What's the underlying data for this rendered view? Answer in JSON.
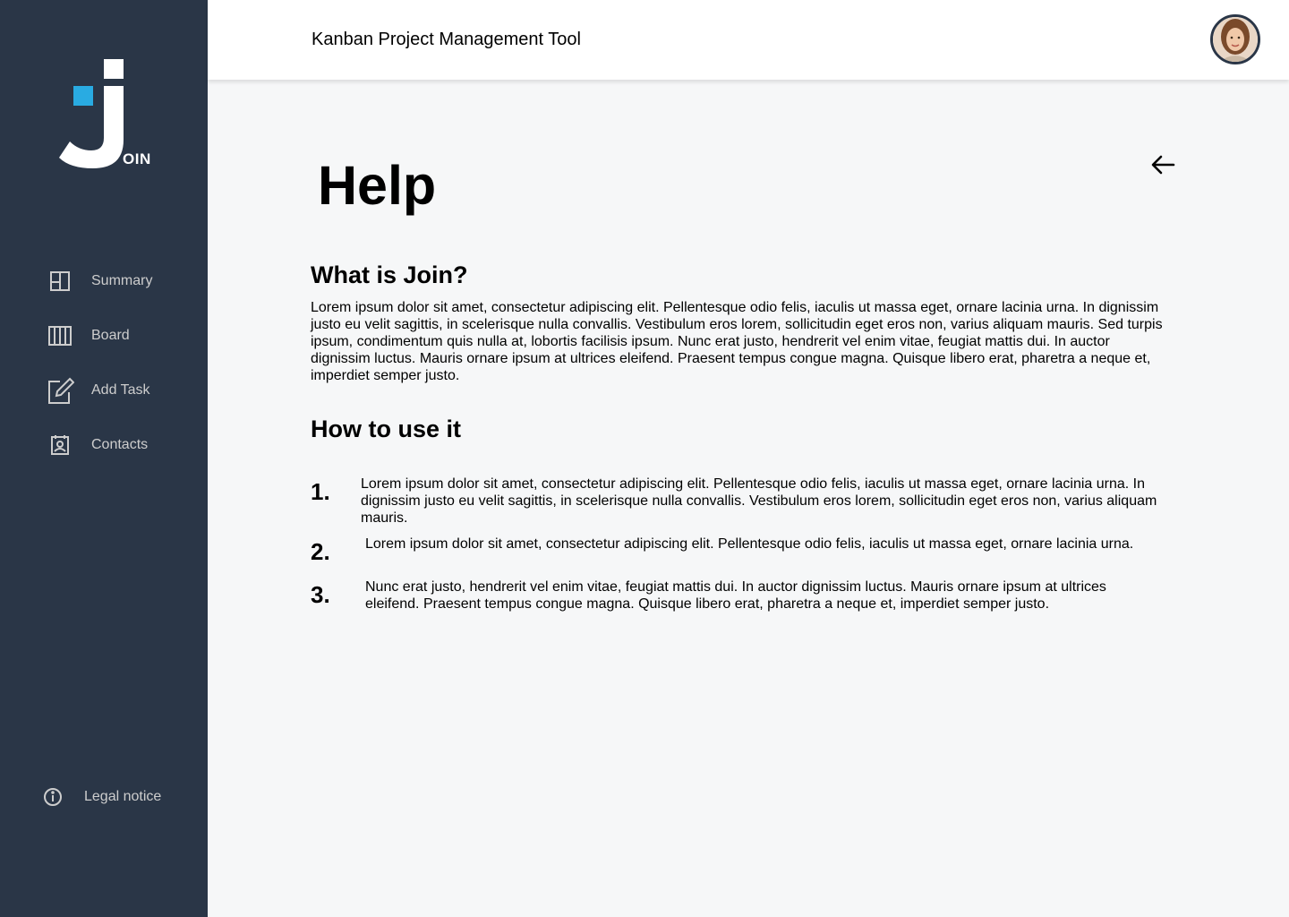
{
  "app": {
    "title": "Kanban Project Management Tool",
    "logo_text": "OIN"
  },
  "sidebar": {
    "items": [
      {
        "label": "Summary",
        "icon": "summary-icon"
      },
      {
        "label": "Board",
        "icon": "board-icon"
      },
      {
        "label": "Add Task",
        "icon": "add-task-icon"
      },
      {
        "label": "Contacts",
        "icon": "contacts-icon"
      }
    ],
    "legal": {
      "label": "Legal notice",
      "icon": "info-icon"
    }
  },
  "page": {
    "title": "Help",
    "section1_title": "What is Join?",
    "section1_text": "Lorem ipsum dolor sit amet, consectetur adipiscing elit. Pellentesque odio felis, iaculis ut massa eget, ornare lacinia urna. In dignissim justo eu velit sagittis, in scelerisque nulla convallis. Vestibulum eros lorem, sollicitudin eget eros non, varius aliquam mauris. Sed turpis ipsum, condimentum quis nulla at, lobortis facilisis ipsum. Nunc erat justo, hendrerit vel enim vitae, feugiat mattis dui. In auctor dignissim luctus. Mauris ornare ipsum at ultrices eleifend. Praesent tempus congue magna. Quisque libero erat, pharetra a neque et, imperdiet semper justo.",
    "section2_title": "How to use it",
    "steps": [
      {
        "num": "1.",
        "text": "Lorem ipsum dolor sit amet, consectetur adipiscing elit. Pellentesque odio felis, iaculis ut massa eget, ornare lacinia urna. In dignissim justo eu velit sagittis, in scelerisque nulla convallis. Vestibulum eros lorem, sollicitudin eget eros non, varius aliquam mauris."
      },
      {
        "num": "2.",
        "text": "Lorem ipsum dolor sit amet, consectetur adipiscing elit. Pellentesque odio felis, iaculis ut massa eget, ornare lacinia urna."
      },
      {
        "num": "3.",
        "text": "Nunc erat justo, hendrerit vel enim vitae, feugiat mattis dui. In auctor dignissim luctus. Mauris ornare ipsum at ultrices eleifend. Praesent tempus congue magna. Quisque libero erat, pharetra a neque et, imperdiet semper justo."
      }
    ]
  },
  "colors": {
    "sidebar_bg": "#2A3647",
    "accent": "#29ABE2",
    "page_bg": "#F6F7F8"
  }
}
